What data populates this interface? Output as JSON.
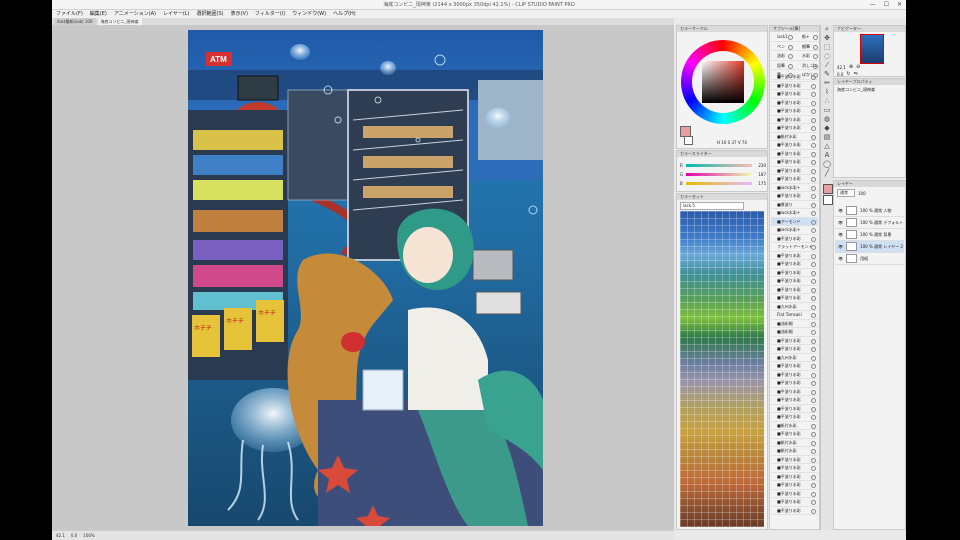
{
  "app": {
    "title": "海底コンビニ_現神楽 (2144 x 3000px 350dpi 42.1%) - CLIP STUDIO PAINT PRO"
  },
  "window_controls": {
    "minimize": "—",
    "maximize": "☐",
    "close": "✕"
  },
  "menu": [
    "ファイル(F)",
    "編集(E)",
    "アニメーション(A)",
    "レイヤー(L)",
    "選択範囲(S)",
    "表示(V)",
    "フィルター(I)",
    "ウィンドウ(W)",
    "ヘルプ(H)"
  ],
  "doc_tabs": [
    "ilast最新(sub) 100",
    "海底コンビニ_現神楽"
  ],
  "colors": {
    "canvas_bg": "#c8c8c8",
    "panel_bg": "#f3f3f3",
    "selection": "#cfe0f5",
    "main_color": "#e8a0a0"
  },
  "color_wheel": {
    "label": "カラーサークル",
    "values_text": "H 16  S 37  V 74"
  },
  "color_slider": {
    "label": "カラースライダー",
    "rows": [
      {
        "label": "R",
        "value": "230"
      },
      {
        "label": "G",
        "value": "187"
      },
      {
        "label": "B",
        "value": "175"
      }
    ]
  },
  "color_set": {
    "label": "カラーセット",
    "set_name": "iack.5"
  },
  "subtools": {
    "header": "サブツール[筆]",
    "items": [
      "■平塗り水彩",
      "■平塗り水彩",
      "■平塗り水彩",
      "■平塗り水彩",
      "■平塗り水彩",
      "■平塗り水彩",
      "■平塗り水彩",
      "■紙付水彩",
      "■平塗り水彩",
      "■平塗り水彩",
      "■平塗り水彩",
      "■平塗り水彩",
      "■平塗り水彩",
      "■iack水彩+",
      "■平塗り水彩",
      "■厚塗り",
      "■iack水彩+",
      "■アーモンド",
      "■iack水彩+",
      "■平塗り水彩",
      "フラットアーモンド",
      "■平塗り水彩",
      "■平塗り水彩",
      "■平塗り水彩",
      "■平塗り水彩",
      "■平塗り水彩",
      "■平塗り水彩",
      "■九州水彩",
      "Flat Tomsaki",
      "■油彩細",
      "■油彩細",
      "■平塗り水彩",
      "■平塗り水彩",
      "■九州水彩",
      "■平塗り水彩",
      "■平塗り水彩",
      "■平塗り水彩",
      "■平塗り水彩",
      "■平塗り水彩",
      "■平塗り水彩",
      "■平塗り水彩",
      "■紙付水彩",
      "■平塗り水彩",
      "■紙付水彩",
      "■紙付水彩",
      "■平塗り水彩",
      "■平塗り水彩",
      "■平塗り水彩",
      "■平塗り水彩",
      "■平塗り水彩",
      "■平塗り水彩",
      "■平塗り水彩"
    ]
  },
  "tool_grid": {
    "header": "ツール",
    "items": [
      "iack1",
      "紙+",
      "ペン",
      "細筆",
      "油彩",
      "水彩",
      "鉛筆",
      "消しゴム",
      "筆",
      "ぼかし",
      "墨",
      "塗り"
    ]
  },
  "navigator": {
    "label": "ナビゲーター",
    "zoom": "42.1",
    "angle": "0.0"
  },
  "layer_property": {
    "label": "レイヤープロパティ",
    "name": "海底コンビニ_現神楽"
  },
  "layers": {
    "header": "レイヤー",
    "blend": "通常",
    "opacity": "100",
    "rows": [
      {
        "name": "100 % 通常\n人物",
        "selected": false
      },
      {
        "name": "100 % 通常\nデフォルト",
        "selected": false
      },
      {
        "name": "100 % 通常\n背景",
        "selected": false
      },
      {
        "name": "100 % 通常\nレイヤー 2",
        "selected": true
      },
      {
        "name": "用紙",
        "selected": false
      }
    ]
  },
  "status": [
    "42.1",
    "0.0",
    "100%"
  ],
  "art": {
    "signs": [
      "ATM",
      "ホチチ",
      "ホチチ",
      "ホチチ"
    ]
  }
}
